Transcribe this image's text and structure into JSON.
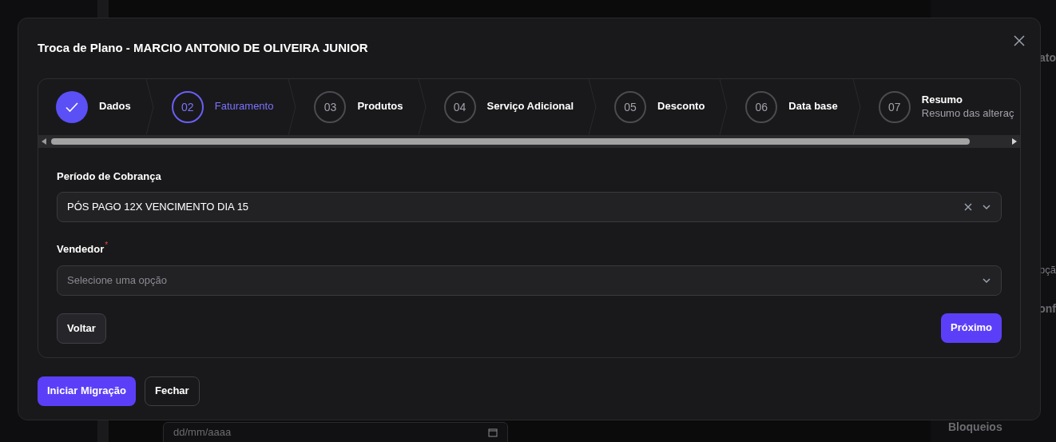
{
  "background": {
    "panel_fragments": [
      "ato",
      "pçã",
      "onf"
    ],
    "section_title": "Bloqueios",
    "date_field": {
      "placeholder": "dd/mm/aaaa"
    }
  },
  "modal": {
    "title": "Troca de Plano - MARCIO ANTONIO DE OLIVEIRA JUNIOR",
    "steps": [
      {
        "label": "Dados",
        "completed": true,
        "selected": false
      },
      {
        "number": "02",
        "label": "Faturamento",
        "completed": false,
        "selected": true
      },
      {
        "number": "03",
        "label": "Produtos",
        "completed": false,
        "selected": false
      },
      {
        "number": "04",
        "label": "Serviço Adicional",
        "completed": false,
        "selected": false
      },
      {
        "number": "05",
        "label": "Desconto",
        "completed": false,
        "selected": false
      },
      {
        "number": "06",
        "label": "Data base",
        "completed": false,
        "selected": false
      },
      {
        "number": "07",
        "label": "Resumo",
        "subtitle": "Resumo das alteraç",
        "completed": false,
        "selected": false
      }
    ],
    "fields": [
      {
        "label": "Período de Cobrança",
        "value": "PÓS PAGO 12X VENCIMENTO DIA 15",
        "clearable": true
      },
      {
        "label": "Vendedor",
        "required_mark": "*",
        "placeholder": "Selecione uma opção",
        "clearable": false
      }
    ],
    "back_button": "Voltar",
    "next_button": "Próximo",
    "footer_buttons": [
      {
        "label": "Iniciar Migração",
        "kind": "primary"
      },
      {
        "label": "Fechar",
        "kind": "outline"
      }
    ]
  }
}
